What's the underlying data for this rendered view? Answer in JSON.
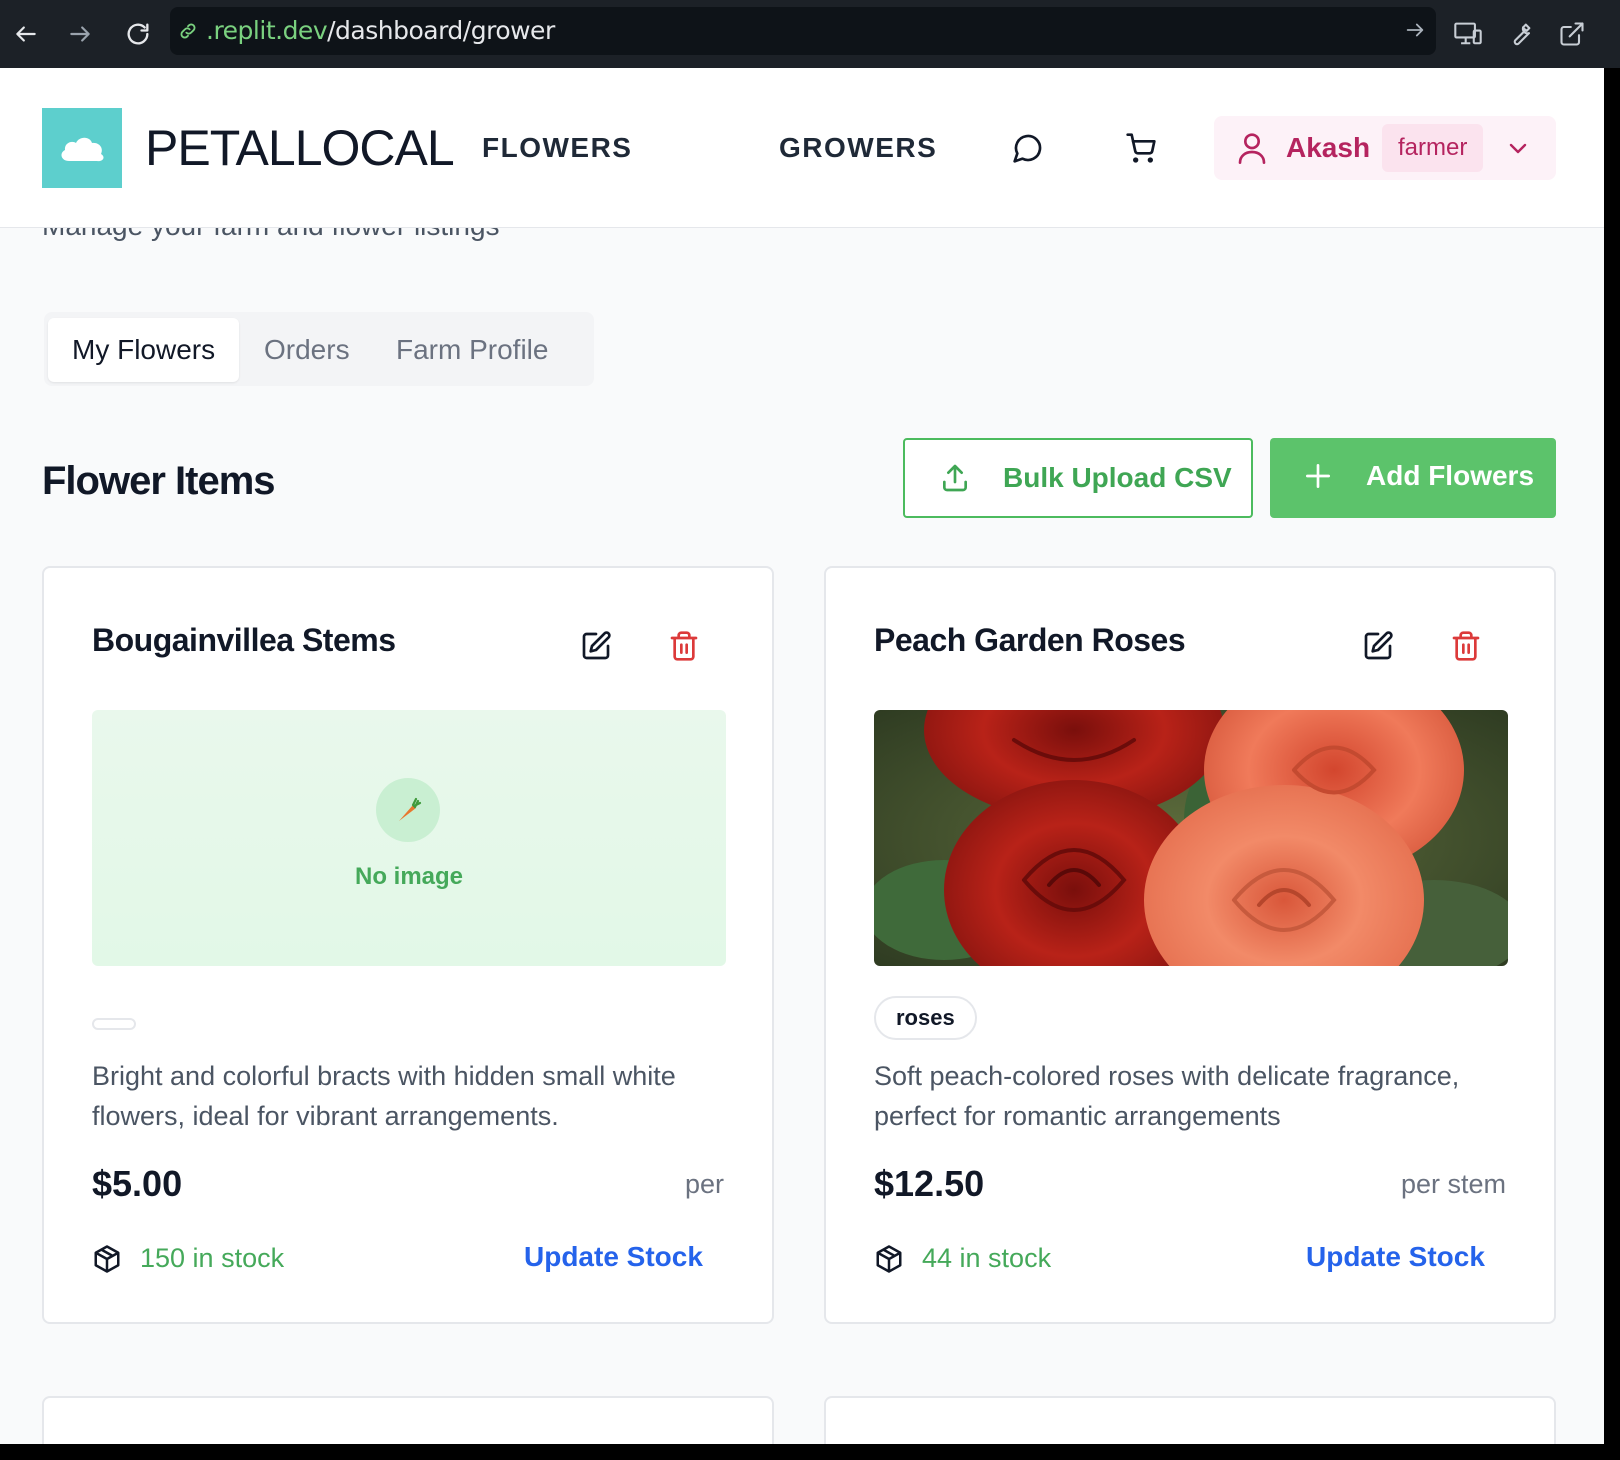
{
  "browser": {
    "url_host": ".replit.dev",
    "url_path": "/dashboard/grower"
  },
  "header": {
    "logo_text": "PETALLOCAL",
    "nav": {
      "flowers": "FLOWERS",
      "growers": "GROWERS"
    },
    "user": {
      "name": "Akash",
      "role": "farmer"
    }
  },
  "page": {
    "subtitle": "Manage your farm and flower listings",
    "tabs": [
      "My Flowers",
      "Orders",
      "Farm Profile"
    ],
    "active_tab": "My Flowers",
    "section_title": "Flower Items",
    "bulk_upload_label": "Bulk Upload CSV",
    "add_flowers_label": "Add Flowers"
  },
  "cards": [
    {
      "title": "Bougainvillea Stems",
      "image_placeholder": "No image",
      "tag": "",
      "description": "Bright and colorful bracts with hidden small white flowers, ideal for vibrant arrangements.",
      "price": "$5.00",
      "unit": "per",
      "stock": "150 in stock",
      "update_label": "Update Stock"
    },
    {
      "title": "Peach Garden Roses",
      "tag": "roses",
      "description": "Soft peach-colored roses with delicate fragrance, perfect for romantic arrangements",
      "price": "$12.50",
      "unit": "per stem",
      "stock": "44 in stock",
      "update_label": "Update Stock"
    }
  ],
  "colors": {
    "brand_teal": "#5dcfcd",
    "primary_green": "#5cc36b",
    "user_accent": "#b5245f",
    "link_blue": "#2563eb",
    "danger_red": "#dc3a3a"
  }
}
